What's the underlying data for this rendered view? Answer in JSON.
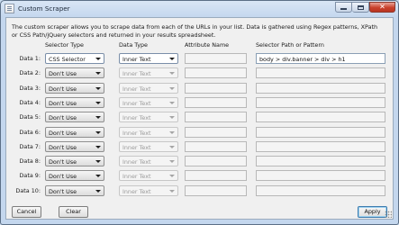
{
  "window": {
    "title": "Custom Scraper"
  },
  "description": "The custom scraper allows you to scrape data from each of the URLs in your list. Data is gathered using Regex patterns, XPath or CSS Path/jQuery selectors and returned in your results spreadsheet.",
  "columns": {
    "selector_type": "Selector Type",
    "data_type": "Data Type",
    "attribute_name": "Attribute Name",
    "selector_path": "Selector Path or Pattern"
  },
  "rows": [
    {
      "label": "Data 1:",
      "selector_type": "CSS Selector",
      "data_type": "Inner Text",
      "attribute": "",
      "selector_path": "body > div.banner > div > h1",
      "enabled": true
    },
    {
      "label": "Data 2:",
      "selector_type": "Don't Use",
      "data_type": "Inner Text",
      "attribute": "",
      "selector_path": "",
      "enabled": false
    },
    {
      "label": "Data 3:",
      "selector_type": "Don't Use",
      "data_type": "Inner Text",
      "attribute": "",
      "selector_path": "",
      "enabled": false
    },
    {
      "label": "Data 4:",
      "selector_type": "Don't Use",
      "data_type": "Inner Text",
      "attribute": "",
      "selector_path": "",
      "enabled": false
    },
    {
      "label": "Data 5:",
      "selector_type": "Don't Use",
      "data_type": "Inner Text",
      "attribute": "",
      "selector_path": "",
      "enabled": false
    },
    {
      "label": "Data 6:",
      "selector_type": "Don't Use",
      "data_type": "Inner Text",
      "attribute": "",
      "selector_path": "",
      "enabled": false
    },
    {
      "label": "Data 7:",
      "selector_type": "Don't Use",
      "data_type": "Inner Text",
      "attribute": "",
      "selector_path": "",
      "enabled": false
    },
    {
      "label": "Data 8:",
      "selector_type": "Don't Use",
      "data_type": "Inner Text",
      "attribute": "",
      "selector_path": "",
      "enabled": false
    },
    {
      "label": "Data 9:",
      "selector_type": "Don't Use",
      "data_type": "Inner Text",
      "attribute": "",
      "selector_path": "",
      "enabled": false
    },
    {
      "label": "Data 10:",
      "selector_type": "Don't Use",
      "data_type": "Inner Text",
      "attribute": "",
      "selector_path": "",
      "enabled": false
    }
  ],
  "buttons": {
    "cancel": "Cancel",
    "clear": "Clear",
    "apply": "Apply"
  },
  "icons": {
    "app": "window-app-icon",
    "minimize": "minimize-icon",
    "maximize": "maximize-icon",
    "close": "close-icon",
    "dropdown": "chevron-down-icon",
    "resize": "resize-grip-icon"
  },
  "colors": {
    "title_bar": "#c4d7ee",
    "close_button": "#c9402b",
    "client_background": "#f0f0f0",
    "default_button_border": "#3d7bad"
  }
}
